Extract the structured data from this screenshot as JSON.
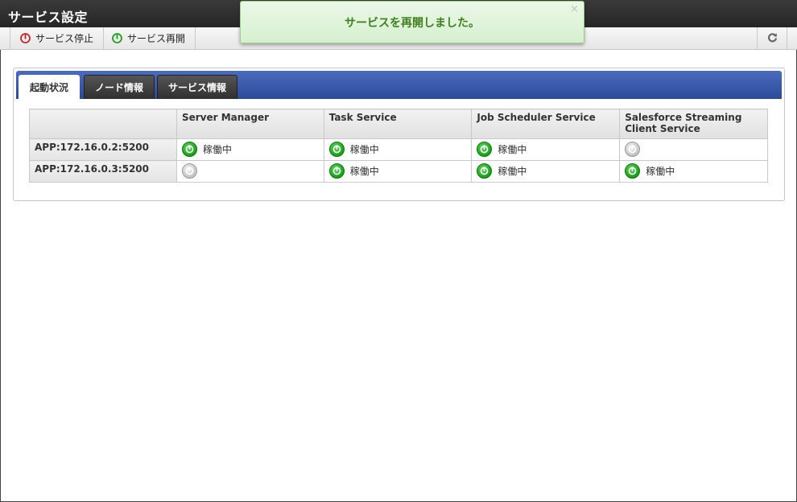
{
  "window": {
    "title": "サービス設定"
  },
  "toolbar": {
    "stop_label": "サービス停止",
    "restart_label": "サービス再開"
  },
  "notification": {
    "message": "サービスを再開しました。",
    "close_glyph": "×"
  },
  "tabs": [
    {
      "label": "起動状況",
      "active": true
    },
    {
      "label": "ノード情報",
      "active": false
    },
    {
      "label": "サービス情報",
      "active": false
    }
  ],
  "table": {
    "headers": [
      "",
      "Server Manager",
      "Task Service",
      "Job Scheduler Service",
      "Salesforce Streaming Client Service"
    ],
    "rows": [
      {
        "node": "APP:172.16.0.2:5200",
        "cells": [
          {
            "status": "running",
            "label": "稼働中"
          },
          {
            "status": "running",
            "label": "稼働中"
          },
          {
            "status": "running",
            "label": "稼働中"
          },
          {
            "status": "stopped",
            "label": ""
          }
        ]
      },
      {
        "node": "APP:172.16.0.3:5200",
        "cells": [
          {
            "status": "stopped",
            "label": ""
          },
          {
            "status": "running",
            "label": "稼働中"
          },
          {
            "status": "running",
            "label": "稼働中"
          },
          {
            "status": "running",
            "label": "稼働中"
          }
        ]
      }
    ]
  },
  "colors": {
    "running": "#18a018",
    "stopped": "#b5b5b5",
    "stop_icon": "#c0282d",
    "restart_icon": "#1aa31a",
    "tab_bar": "#2c4a9a",
    "notice_text": "#3f7f1f"
  },
  "icons": {
    "stop": "power-icon-red",
    "restart": "power-icon-green",
    "refresh": "refresh-icon",
    "status_running": "power-icon-green",
    "status_stopped": "power-icon-gray"
  }
}
